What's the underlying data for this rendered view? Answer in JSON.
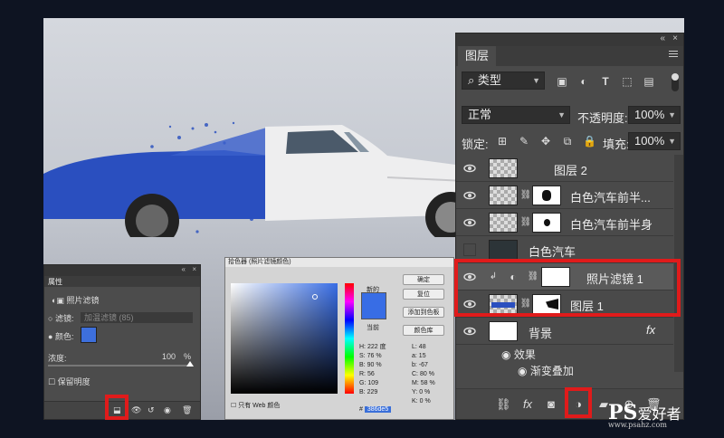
{
  "layers_panel": {
    "tab_label": "图层",
    "collapse_glyph": "«",
    "close_glyph": "×",
    "filter_kind": "类型",
    "blend_mode": "正常",
    "opacity_label": "不透明度:",
    "opacity_value": "100%",
    "lock_label": "锁定:",
    "fill_label": "填充:",
    "fill_value": "100%",
    "layers": [
      {
        "name": "图层 2",
        "visible": true
      },
      {
        "name": "白色汽车前半...",
        "visible": true
      },
      {
        "name": "白色汽车前半身",
        "visible": true
      },
      {
        "name": "白色汽车",
        "visible": false
      },
      {
        "name": "照片滤镜 1",
        "visible": true
      },
      {
        "name": "图层 1",
        "visible": true
      },
      {
        "name": "背景",
        "visible": true
      }
    ],
    "effects_label": "效果",
    "effect_item": "渐变叠加",
    "fx_label": "fx",
    "highlight_color": "#e01b1b"
  },
  "properties_panel": {
    "tab_label": "属性",
    "title": "照片滤镜",
    "filter_label": "滤镜:",
    "filter_value": "加温滤镜 (85)",
    "color_label": "颜色:",
    "color_value": "#3d6fdc",
    "density_label": "浓度:",
    "density_value": "100",
    "density_unit": "%",
    "preserve_label": "保留明度"
  },
  "color_picker": {
    "title": "拾色器 (照片滤镜颜色)",
    "new_label": "新的",
    "current_label": "当前",
    "ok_label": "确定",
    "reset_label": "复位",
    "add_swatch_label": "添加到色板",
    "libraries_label": "颜色库",
    "web_only_label": "只有 Web 颜色",
    "fields": [
      {
        "label": "H:",
        "value": "222",
        "unit": "度"
      },
      {
        "label": "S:",
        "value": "76",
        "unit": "%"
      },
      {
        "label": "B:",
        "value": "90",
        "unit": "%"
      },
      {
        "label": "R:",
        "value": "56",
        "unit": ""
      },
      {
        "label": "G:",
        "value": "109",
        "unit": ""
      },
      {
        "label": "B:",
        "value": "229",
        "unit": ""
      }
    ],
    "lab_fields": [
      {
        "label": "L:",
        "value": "48"
      },
      {
        "label": "a:",
        "value": "15"
      },
      {
        "label": "b:",
        "value": "-67"
      },
      {
        "label": "C:",
        "value": "80",
        "unit": "%"
      },
      {
        "label": "M:",
        "value": "58",
        "unit": "%"
      },
      {
        "label": "Y:",
        "value": "0",
        "unit": "%"
      },
      {
        "label": "K:",
        "value": "0",
        "unit": "%"
      }
    ],
    "hex_label": "#",
    "hex_value": "386de5",
    "selected_color": "#386de5"
  },
  "watermark": {
    "brand": "PS",
    "text": "爱好者",
    "url": "www.psahz.com"
  }
}
